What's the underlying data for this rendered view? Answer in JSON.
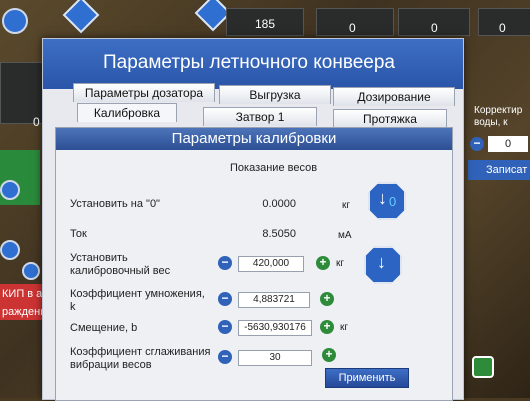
{
  "background": {
    "top_value_185": "185",
    "top_value_a": "0",
    "top_value_b": "0",
    "top_value_c": "0",
    "left_value": "0",
    "left_text_1": "КИП в ава",
    "left_text_2": "раждение в",
    "right_label": "Корректир воды, к",
    "right_value": "0",
    "right_button": "Записат"
  },
  "dialog": {
    "title": "Параметры летночного конвеера",
    "tabs_row1": [
      "Параметры дозатора",
      "Выгрузка",
      "Дозирование"
    ],
    "tabs_row2": [
      "Калибровка",
      "Затвор 1",
      "Протяжка"
    ],
    "section_header": "Параметры калибровки",
    "weight_header": "Показание весов",
    "rows": {
      "zero": {
        "label": "Установить на \"0\"",
        "value": "0.0000",
        "unit": "кг"
      },
      "current": {
        "label": "Ток",
        "value": "8.5050",
        "unit": "мА"
      },
      "calib": {
        "label": "Установить калибровочный вес",
        "value": "420,000",
        "unit": "кг"
      },
      "mult": {
        "label": "Коэффициент умножения, k",
        "value": "4,883721"
      },
      "offset": {
        "label": "Смещение, b",
        "value": "-5630,930176",
        "unit": "кг"
      },
      "smooth": {
        "label": "Коэффициент сглаживания вибрации весов",
        "value": "30"
      }
    },
    "apply_button": "Применить"
  },
  "colors": {
    "title_blue": "#2a55a8",
    "minus_blue": "#2f62b8",
    "plus_green": "#2e8b3a"
  },
  "icons": {
    "zero_button": "arrow-down-zero-icon",
    "set_calib_button": "arrow-down-icon",
    "minus": "minus-icon",
    "plus": "plus-icon"
  }
}
